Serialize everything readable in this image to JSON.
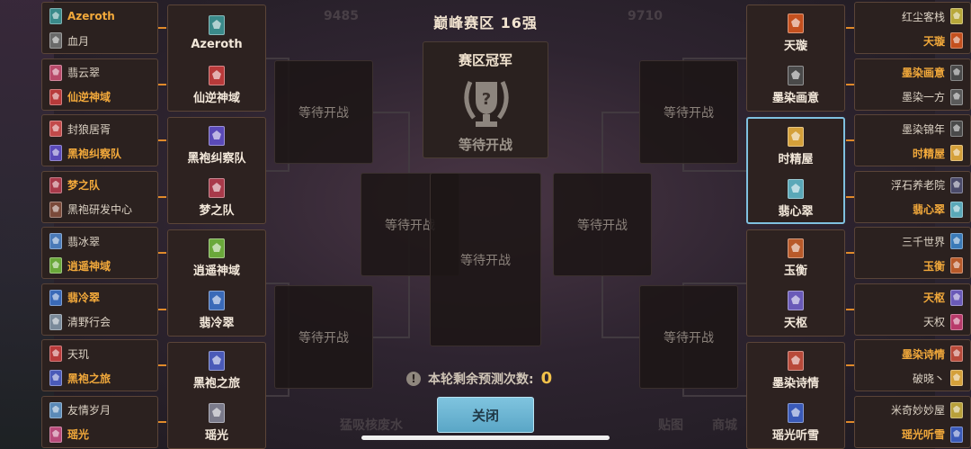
{
  "title": "巅峰赛区  16强",
  "champion": {
    "title": "赛区冠军",
    "status": "等待开战"
  },
  "waiting_label": "等待开战",
  "predict": {
    "label": "本轮剩余预测次数:",
    "count": "0"
  },
  "close_label": "关闭",
  "background_text": {
    "left_num": "9485",
    "mid_num": "9710",
    "chat": "猛吸核废水",
    "bottom_right": "商城",
    "bottom_mid": "贴图"
  },
  "left_teams": [
    {
      "a": "Azeroth",
      "b": "血月",
      "winner": "a",
      "ca": "#3a8a8a",
      "cb": "#6a6a6a"
    },
    {
      "a": "翡云翠",
      "b": "仙逆神域",
      "winner": "b",
      "ca": "#b84a6a",
      "cb": "#b83a3a"
    },
    {
      "a": "封狼居胥",
      "b": "黑袍纠察队",
      "winner": "b",
      "ca": "#c24a4a",
      "cb": "#5a4ab8"
    },
    {
      "a": "梦之队",
      "b": "黑袍研发中心",
      "winner": "a",
      "ca": "#a83a4a",
      "cb": "#7a4a3a"
    },
    {
      "a": "翡冰翠",
      "b": "逍遥神域",
      "winner": "b",
      "ca": "#4a7ab8",
      "cb": "#6aa83a"
    },
    {
      "a": "翡冷翠",
      "b": "清野行会",
      "winner": "a",
      "ca": "#3a6ab8",
      "cb": "#7a8a9a"
    },
    {
      "a": "天玑",
      "b": "黑袍之旅",
      "winner": "b",
      "ca": "#b83a3a",
      "cb": "#4a5ab8"
    },
    {
      "a": "友情岁月",
      "b": "瑶光",
      "winner": "b",
      "ca": "#5a8ab8",
      "cb": "#b84a7a"
    }
  ],
  "left_r16": [
    {
      "a": "Azeroth",
      "b": "仙逆神域",
      "ca": "#3a8a8a",
      "cb": "#b83a3a"
    },
    {
      "a": "黑袍纠察队",
      "b": "梦之队",
      "ca": "#5a4ab8",
      "cb": "#a83a4a"
    },
    {
      "a": "逍遥神域",
      "b": "翡冷翠",
      "ca": "#6aa83a",
      "cb": "#3a6ab8"
    },
    {
      "a": "黑袍之旅",
      "b": "瑶光",
      "ca": "#4a5ab8",
      "cb": "#7a7a8a"
    }
  ],
  "right_teams": [
    {
      "a": "红尘客栈",
      "b": "天璇",
      "winner": "b",
      "ca": "#b8a83a",
      "cb": "#c4501e"
    },
    {
      "a": "墨染画意",
      "b": "墨染一方",
      "winner": "a",
      "ca": "#4a4a4a",
      "cb": "#5a5a5a"
    },
    {
      "a": "墨染锦年",
      "b": "时精屋",
      "winner": "b",
      "ca": "#4a4a4a",
      "cb": "#d4a03a"
    },
    {
      "a": "浮石养老院",
      "b": "翡心翠",
      "winner": "b",
      "ca": "#4a4a6a",
      "cb": "#5aa8b8"
    },
    {
      "a": "三千世界",
      "b": "玉衡",
      "winner": "b",
      "ca": "#3a7ab8",
      "cb": "#b85a2a"
    },
    {
      "a": "天枢",
      "b": "天权",
      "winner": "a",
      "ca": "#6a5ab8",
      "cb": "#b83a6a"
    },
    {
      "a": "墨染诗情",
      "b": "破晓丶",
      "winner": "a",
      "ca": "#b84a3a",
      "cb": "#d4a03a"
    },
    {
      "a": "米奇妙妙屋",
      "b": "瑶光听雪",
      "winner": "b",
      "ca": "#b8a03a",
      "cb": "#3a5ab8"
    }
  ],
  "right_r16": [
    {
      "a": "天璇",
      "b": "墨染画意",
      "ca": "#c4501e",
      "cb": "#4a4a4a"
    },
    {
      "a": "时精屋",
      "b": "翡心翠",
      "ca": "#d4a03a",
      "cb": "#5aa8b8"
    },
    {
      "a": "玉衡",
      "b": "天枢",
      "ca": "#b85a2a",
      "cb": "#6a5ab8"
    },
    {
      "a": "墨染诗情",
      "b": "瑶光听雪",
      "ca": "#b84a3a",
      "cb": "#3a5ab8"
    }
  ]
}
